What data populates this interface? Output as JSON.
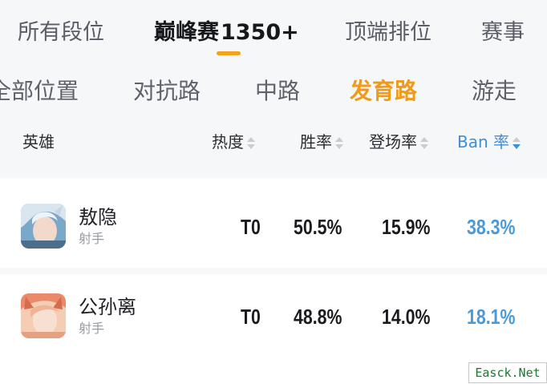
{
  "rank_tabs": [
    "所有段位",
    "巅峰赛",
    "1350+",
    "顶端排位",
    "赛事"
  ],
  "position_tabs": [
    "全部位置",
    "对抗路",
    "中路",
    "发育路",
    "游走"
  ],
  "table_header": {
    "hero": "英雄",
    "heat": "热度",
    "win_rate": "胜率",
    "pick_rate": "登场率",
    "ban_rate": "Ban 率"
  },
  "rows": [
    {
      "name": "敖隐",
      "role": "射手",
      "tier": "T0",
      "win_rate": "50.5%",
      "pick_rate": "15.9%",
      "ban_rate": "38.3%"
    },
    {
      "name": "公孙离",
      "role": "射手",
      "tier": "T0",
      "win_rate": "48.8%",
      "pick_rate": "14.0%",
      "ban_rate": "18.1%"
    }
  ],
  "watermark": "Easck.Net",
  "colors": {
    "accent_orange": "#f09a1a",
    "accent_blue": "#3d8fd8"
  },
  "active": {
    "rank_tab": "巅峰赛 1350+",
    "position_tab": "发育路",
    "sort_column": "Ban 率",
    "sort_order": "descending"
  }
}
